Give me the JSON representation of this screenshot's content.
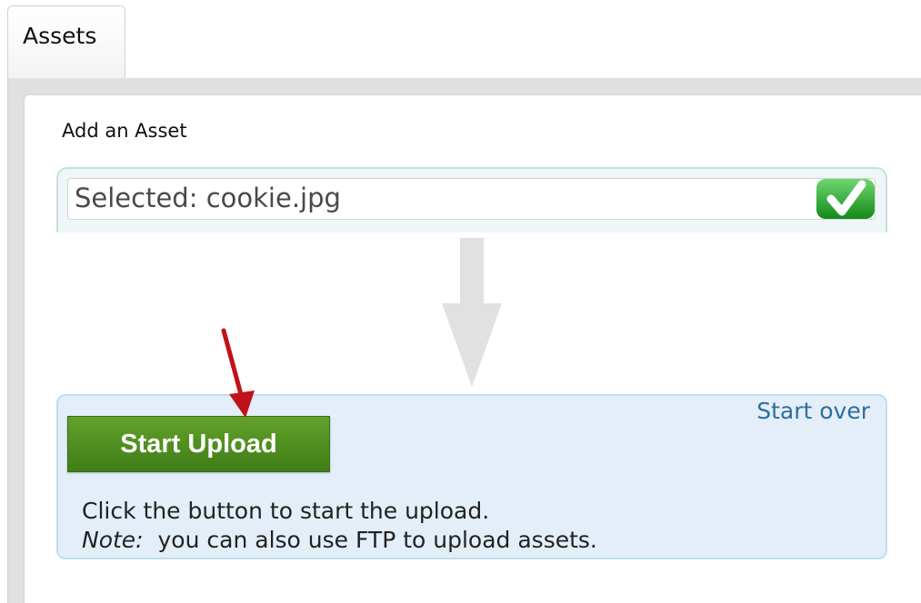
{
  "tabs": [
    {
      "label": "Assets"
    }
  ],
  "panel": {
    "title": "Add an Asset"
  },
  "file_selector": {
    "text": "Selected: cookie.jpg",
    "status_icon": "checkmark-icon",
    "status_color": "#2fa32f"
  },
  "upload": {
    "button_label": "Start Upload",
    "start_over_label": "Start over",
    "help_line1": "Click the button to start the upload.",
    "note_label": "Note:",
    "note_text": "you can also use FTP to upload assets."
  },
  "colors": {
    "button": "#4f8f22",
    "link": "#2d6f9c",
    "annotation_arrow": "#c0121a"
  }
}
